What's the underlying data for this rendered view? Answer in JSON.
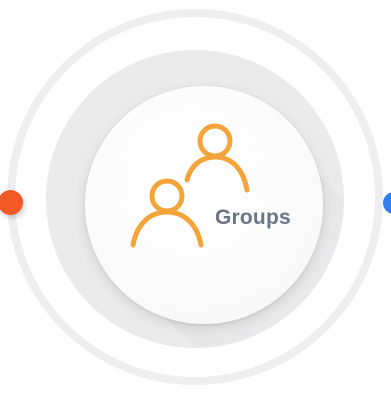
{
  "node": {
    "label": "Groups",
    "icon": "users-icon",
    "icon_color": "#f4a43a",
    "label_color": "#6a7585"
  },
  "connectors": {
    "left_dot_color": "#f15a24",
    "right_dot_color": "#2f7ef0"
  }
}
